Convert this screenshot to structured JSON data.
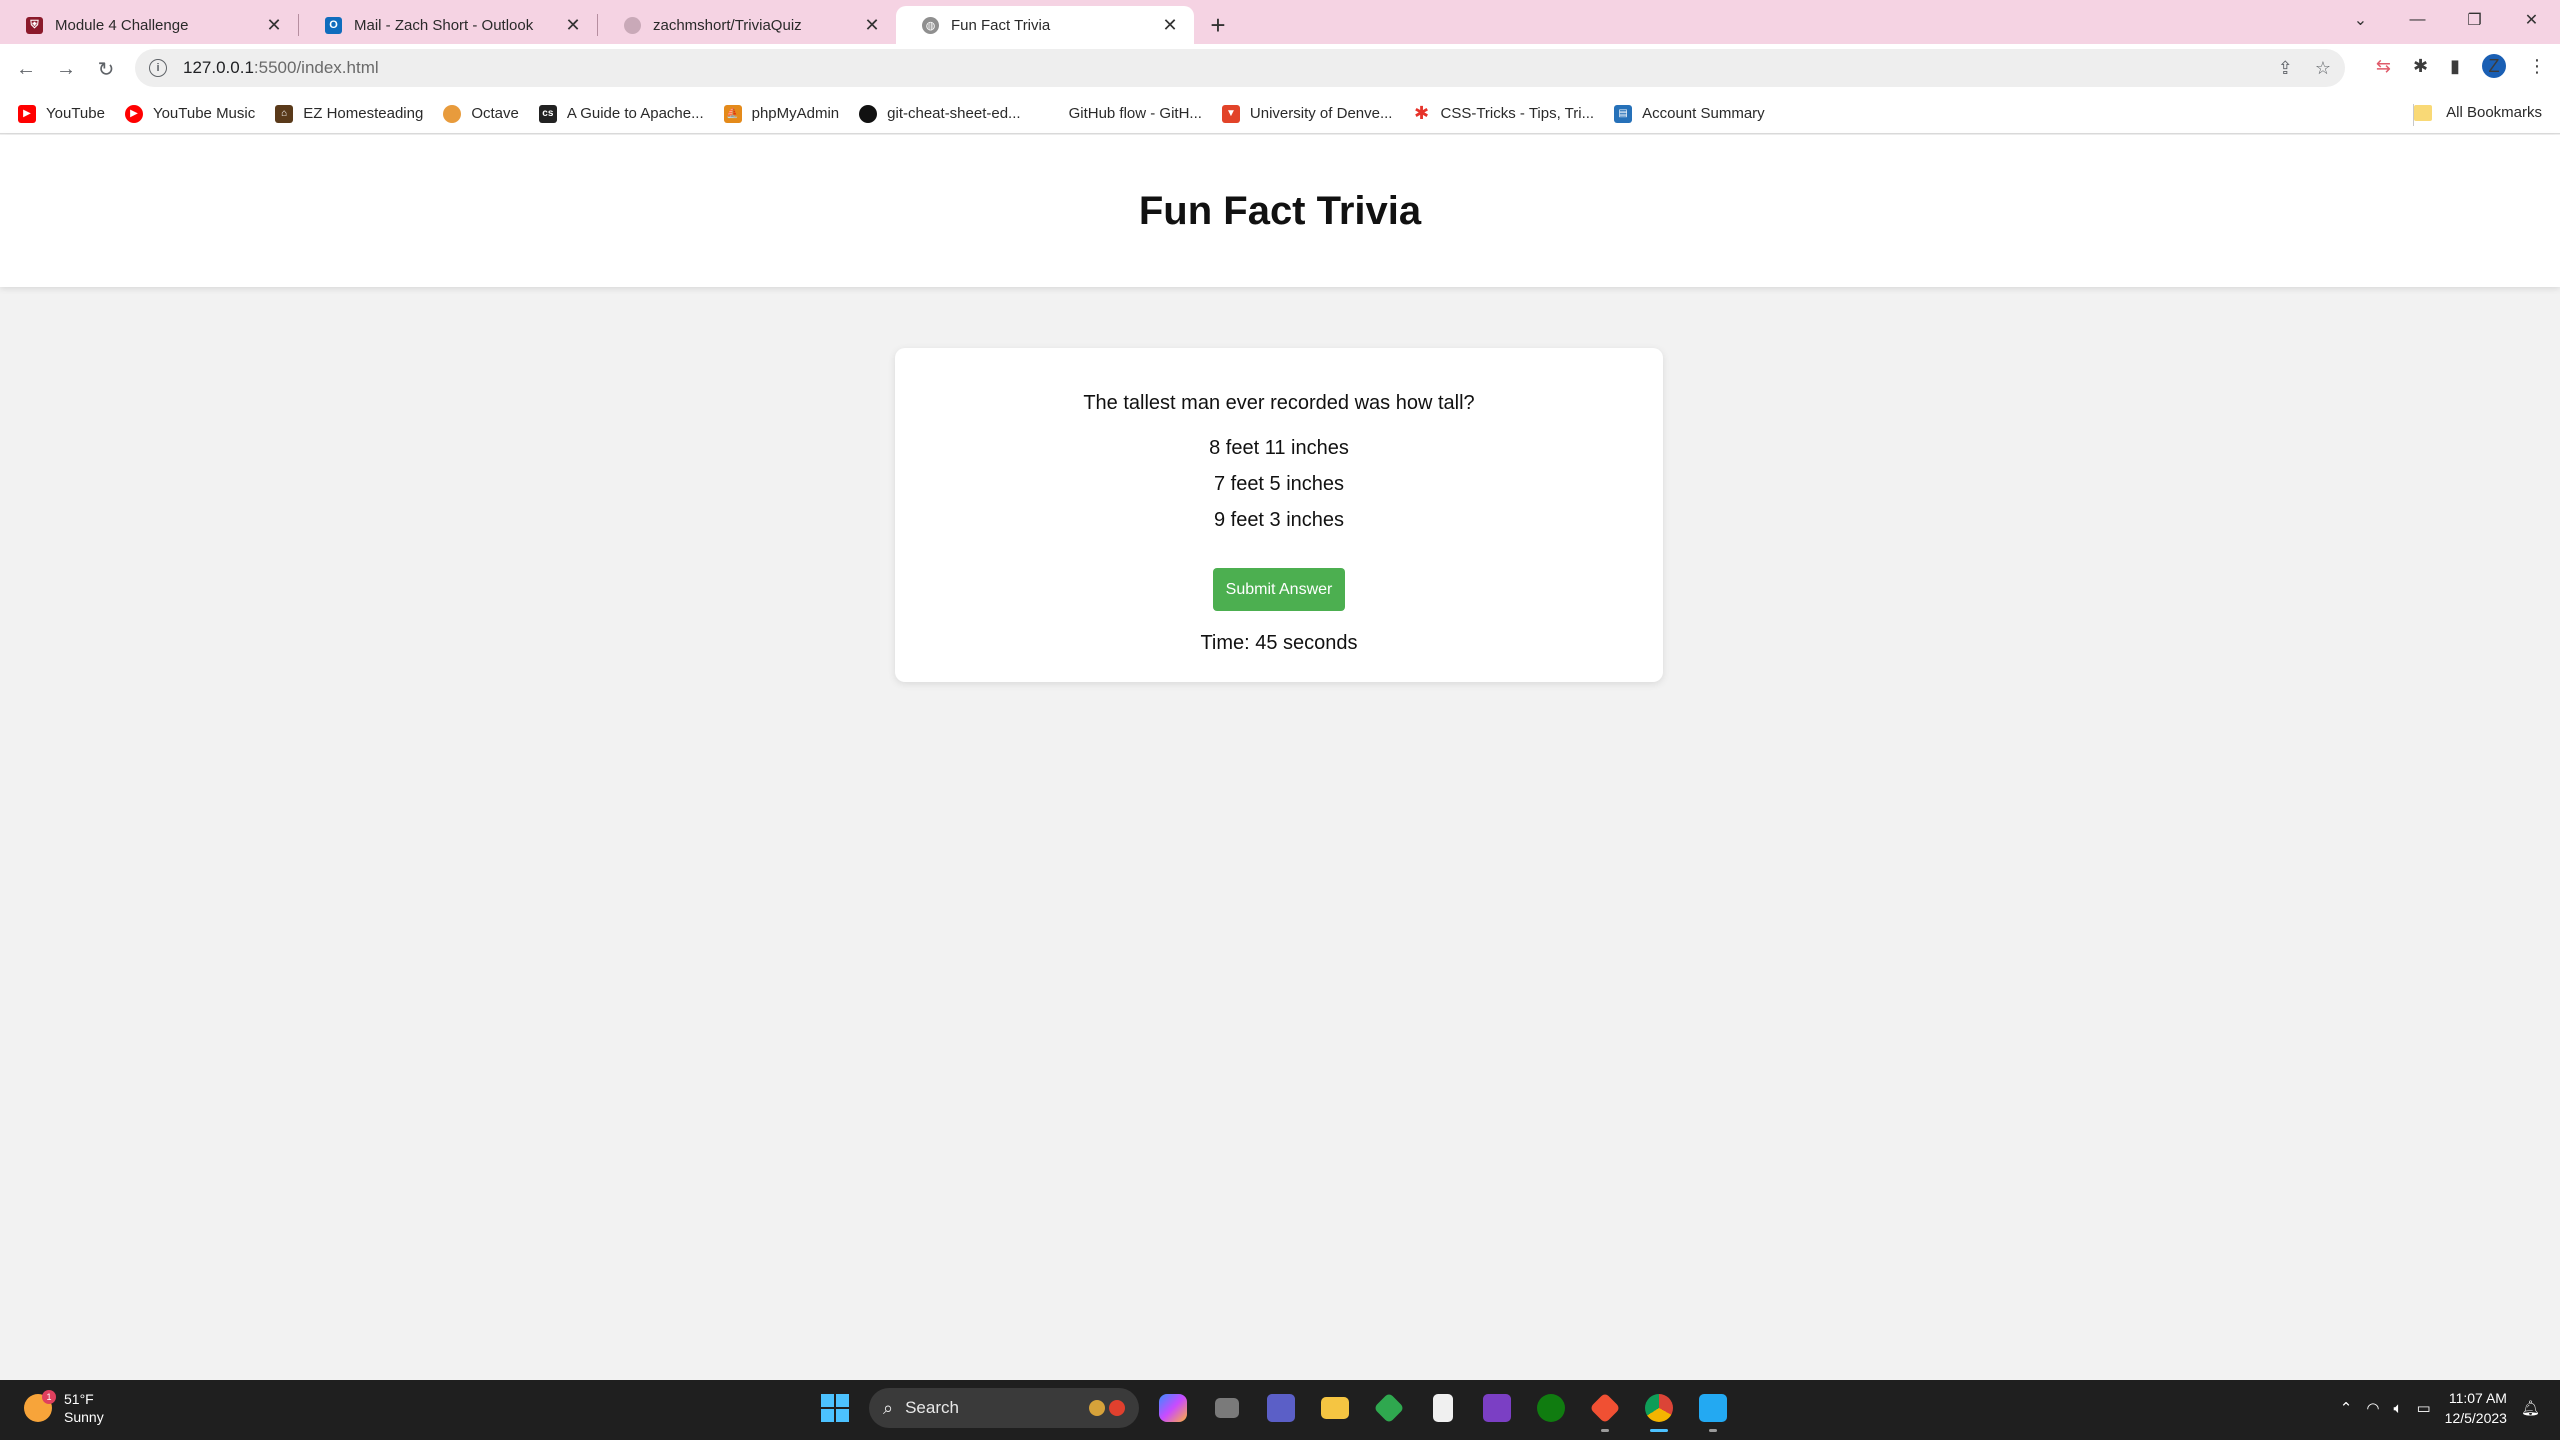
{
  "browser": {
    "tabs": [
      {
        "title": "Module 4 Challenge",
        "icon": "shield-favicon",
        "color": "#8b1a2b",
        "active": false
      },
      {
        "title": "Mail - Zach Short - Outlook",
        "icon": "outlook-favicon",
        "color": "#0f6cbd",
        "active": false
      },
      {
        "title": "zachmshort/TriviaQuiz",
        "icon": "github-favicon",
        "color": "#c9a9b8",
        "active": false
      },
      {
        "title": "Fun Fact Trivia",
        "icon": "globe-favicon",
        "color": "#8f8f8f",
        "active": true
      }
    ],
    "url_host": "127.0.0.1",
    "url_path": ":5500/index.html",
    "profile_initial": "Z"
  },
  "bookmarks": [
    {
      "label": "YouTube",
      "icon": "youtube-icon",
      "color": "#ff0000"
    },
    {
      "label": "YouTube Music",
      "icon": "youtube-music-icon",
      "color": "#ff0000"
    },
    {
      "label": "EZ Homesteading",
      "icon": "homestead-icon",
      "color": "#5a3a1a"
    },
    {
      "label": "Octave",
      "icon": "octave-icon",
      "color": "#e89b3c"
    },
    {
      "label": "A Guide to Apache...",
      "icon": "css-icon",
      "color": "#222222"
    },
    {
      "label": "phpMyAdmin",
      "icon": "phpmyadmin-icon",
      "color": "#e48a1a"
    },
    {
      "label": "git-cheat-sheet-ed...",
      "icon": "github-icon",
      "color": "#111111"
    },
    {
      "label": "GitHub flow - GitH...",
      "icon": "blank-icon",
      "color": "#ffffff"
    },
    {
      "label": "University of Denve...",
      "icon": "gitlab-icon",
      "color": "#e24329"
    },
    {
      "label": "CSS-Tricks - Tips, Tri...",
      "icon": "star-icon",
      "color": "#e6332a"
    },
    {
      "label": "Account Summary",
      "icon": "amex-icon",
      "color": "#2671b9"
    }
  ],
  "all_bookmarks_label": "All Bookmarks",
  "page": {
    "title": "Fun Fact Trivia",
    "question": "The tallest man ever recorded was how tall?",
    "answers": [
      "8 feet 11 inches",
      "7 feet 5 inches",
      "9 feet 3 inches"
    ],
    "submit_label": "Submit Answer",
    "timer_text": "Time: 45 seconds",
    "accent_color": "#4caf50"
  },
  "taskbar": {
    "weather_temp": "51°F",
    "weather_desc": "Sunny",
    "weather_badge": "1",
    "search_label": "Search",
    "time": "11:07 AM",
    "date": "12/5/2023"
  }
}
